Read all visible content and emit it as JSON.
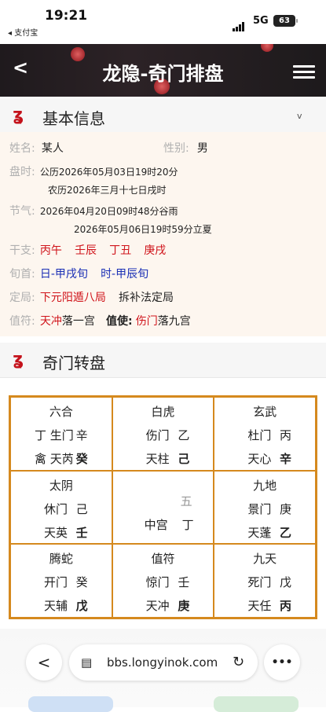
{
  "status": {
    "time": "19:21",
    "back_app": "◂ 支付宝",
    "network": "5G",
    "battery": "63"
  },
  "nav": {
    "back": "<",
    "title": "龙隐-奇门排盘"
  },
  "basic": {
    "header": "基本信息",
    "chevron": "v",
    "name_label": "姓名:",
    "name_value": "某人",
    "gender_label": "性别:",
    "gender_value": "男",
    "time_label": "盘时:",
    "solar": "公历2026年05月03日19时20分",
    "lunar": "农历2026年三月十七日戌时",
    "jieqi_label": "节气:",
    "jieqi1": "2026年04月20日09时48分谷雨",
    "jieqi2": "2026年05月06日19时59分立夏",
    "ganzhi_label": "干支:",
    "ganzhi": [
      "丙午",
      "壬辰",
      "丁丑",
      "庚戌"
    ],
    "xunshou_label": "旬首:",
    "xunshou": [
      "日-甲戌旬",
      "时-甲辰旬"
    ],
    "ju_label": "定局:",
    "ju_value": "下元阳遁八局",
    "ju_method": "拆补法定局",
    "zhifu_label": "值符:",
    "zhifu_star": "天冲",
    "zhifu_palace": "落一宫",
    "zhishi_label": "值使:",
    "zhishi_door": "伤门",
    "zhishi_palace": "落九宫"
  },
  "pan": {
    "header": "奇门转盘",
    "cells": [
      {
        "god": "六合",
        "l2a": "丁 生门",
        "l2b": "辛",
        "l3a": "禽 天芮",
        "l3b": "癸"
      },
      {
        "god": "白虎",
        "l2a": "伤门",
        "l2b": "乙",
        "l3a": "天柱",
        "l3b": "己"
      },
      {
        "god": "玄武",
        "l2a": "杜门",
        "l2b": "丙",
        "l3a": "天心",
        "l3b": "辛"
      },
      {
        "god": "太阴",
        "l2a": "休门",
        "l2b": "己",
        "l3a": "天英",
        "l3b": "壬"
      },
      {
        "five": "五",
        "mid": "中宫",
        "midb": "丁"
      },
      {
        "god": "九地",
        "l2a": "景门",
        "l2b": "庚",
        "l3a": "天蓬",
        "l3b": "乙"
      },
      {
        "god": "腾蛇",
        "l2a": "开门",
        "l2b": "癸",
        "l3a": "天辅",
        "l3b": "戊"
      },
      {
        "god": "值符",
        "l2a": "惊门",
        "l2b": "壬",
        "l3a": "天冲",
        "l3b": "庚"
      },
      {
        "god": "九天",
        "l2a": "死门",
        "l2b": "戊",
        "l3a": "天任",
        "l3b": "丙"
      }
    ]
  },
  "browser": {
    "url": "bbs.longyinok.com",
    "back": "<",
    "more": "•••",
    "page_icon": "▤",
    "reload": "↻"
  }
}
